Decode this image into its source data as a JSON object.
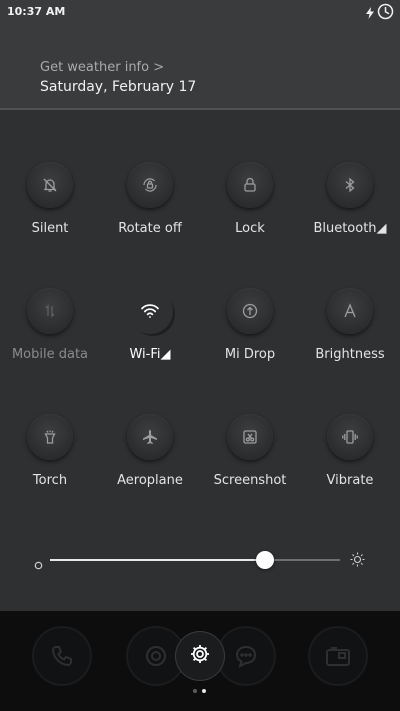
{
  "status_bar": {
    "time": "10:37 AM",
    "icons": [
      "charging-icon",
      "clock-icon"
    ]
  },
  "weather": {
    "link": "Get weather info >",
    "date": "Saturday, February 17"
  },
  "toggles": [
    {
      "label": "Silent",
      "icon": "bell-off-icon",
      "state": "off"
    },
    {
      "label": "Rotate off",
      "icon": "rotate-lock-icon",
      "state": "off"
    },
    {
      "label": "Lock",
      "icon": "lock-icon",
      "state": "off"
    },
    {
      "label": "Bluetooth◢",
      "icon": "bluetooth-icon",
      "state": "off"
    },
    {
      "label": "Mobile data",
      "icon": "mobile-data-icon",
      "state": "disabled"
    },
    {
      "label": "Wi-Fi◢",
      "icon": "wifi-icon",
      "state": "on"
    },
    {
      "label": "Mi Drop",
      "icon": "mi-drop-icon",
      "state": "off"
    },
    {
      "label": "Brightness",
      "icon": "brightness-auto-icon",
      "state": "off"
    },
    {
      "label": "Torch",
      "icon": "torch-icon",
      "state": "off"
    },
    {
      "label": "Aeroplane",
      "icon": "airplane-icon",
      "state": "off"
    },
    {
      "label": "Screenshot",
      "icon": "screenshot-icon",
      "state": "off"
    },
    {
      "label": "Vibrate",
      "icon": "vibrate-icon",
      "state": "off"
    }
  ],
  "brightness": {
    "level": 0.74
  },
  "dock": {
    "apps": [
      "phone-icon",
      "browser-icon",
      "messages-icon",
      "camera-icon"
    ],
    "pages": 2,
    "current_page": 2
  }
}
